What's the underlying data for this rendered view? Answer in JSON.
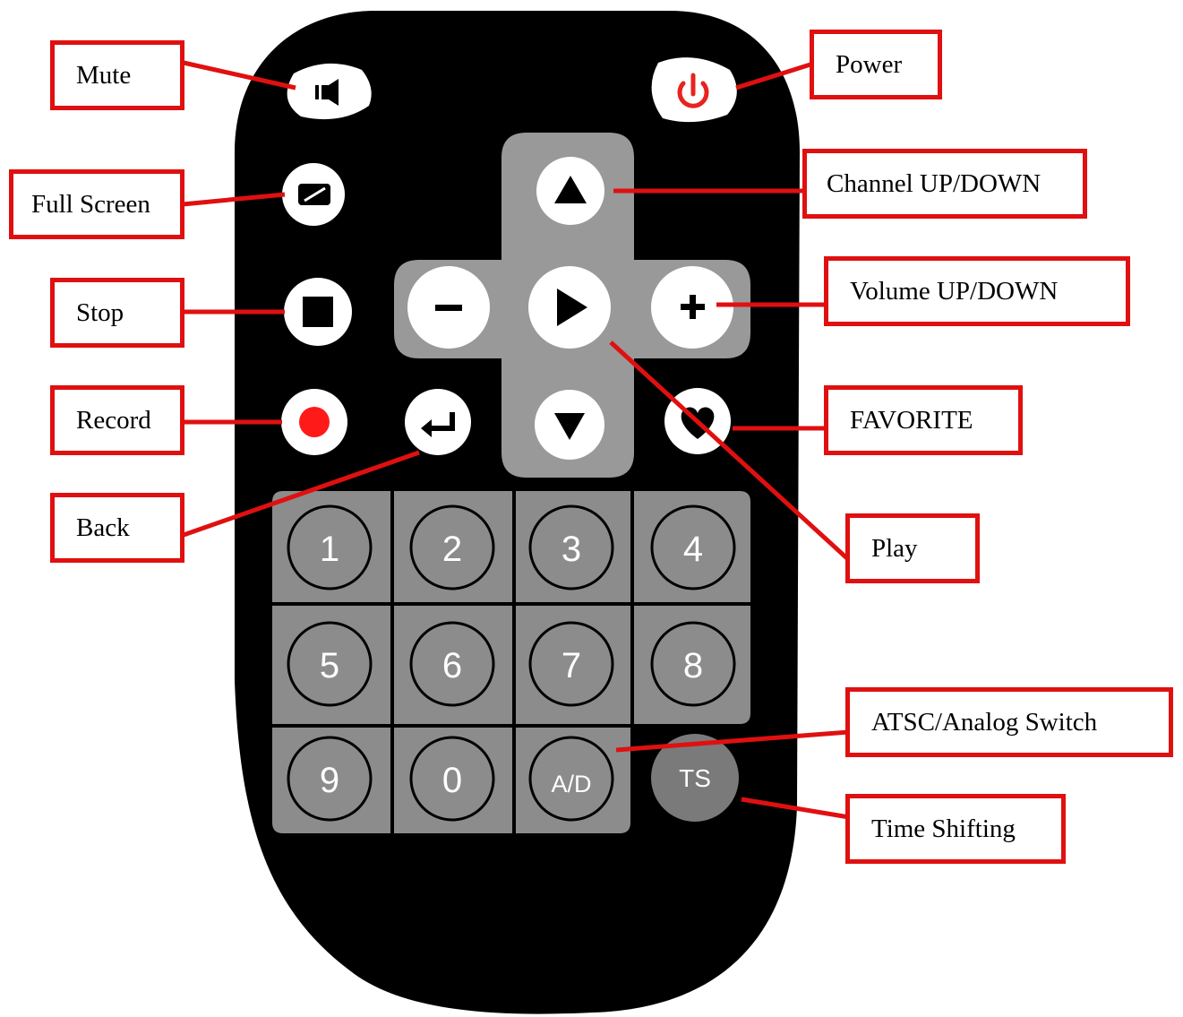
{
  "callouts": {
    "mute": "Mute",
    "power": "Power",
    "full_screen": "Full Screen",
    "channel": "Channel UP/DOWN",
    "stop": "Stop",
    "volume": "Volume UP/DOWN",
    "record": "Record",
    "favorite": "FAVORITE",
    "back": "Back",
    "play": "Play",
    "atsc": "ATSC/Analog Switch",
    "time_shifting": "Time Shifting"
  },
  "keypad": {
    "row1": [
      "1",
      "2",
      "3",
      "4"
    ],
    "row2": [
      "5",
      "6",
      "7",
      "8"
    ],
    "row3": [
      "9",
      "0",
      "A/D"
    ],
    "ts": "TS"
  },
  "colors": {
    "remote_body": "#000000",
    "keypad_panel": "#8c8c8c",
    "button_white": "#ffffff",
    "callout_border": "#e01010",
    "record_dot": "#ff1a1a",
    "power_icon": "#e8231f"
  }
}
